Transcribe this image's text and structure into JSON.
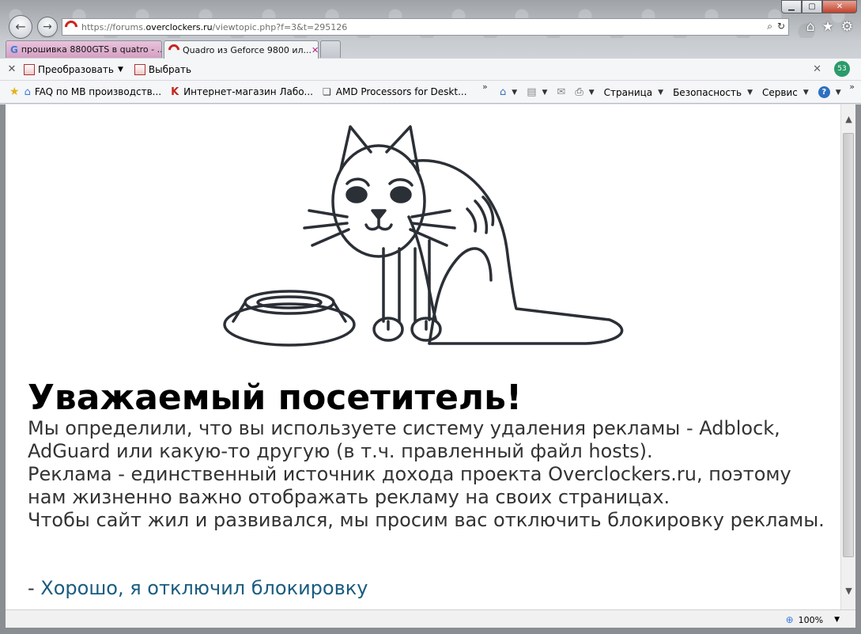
{
  "window": {
    "min_glyph": "▁",
    "max_glyph": "▢",
    "close_glyph": "✕"
  },
  "nav": {
    "back_glyph": "←",
    "fwd_glyph": "→"
  },
  "address": {
    "url_prefix": "https://forums.",
    "url_domain": "overclockers.ru",
    "url_suffix": "/viewtopic.php?f=3&t=295126",
    "search_glyph": "⌕",
    "refresh_glyph": "↻"
  },
  "right_icons": {
    "home": "⌂",
    "favorites": "★",
    "tools": "⚙"
  },
  "tabs": [
    {
      "label": "прошивка 8800GTS в quatro - ...",
      "icon": "G"
    },
    {
      "label": "Quadro из Geforce 9800 ил...",
      "close": "✕"
    }
  ],
  "command_bar": {
    "close": "✕",
    "convert": "Преобразовать",
    "select": "Выбрать",
    "right_close": "✕",
    "badge": "53"
  },
  "favorites": [
    {
      "label": "FAQ по МВ производств..."
    },
    {
      "label": "Интернет-магазин  Лабо..."
    },
    {
      "label": "AMD Processors for Deskt..."
    }
  ],
  "chevron": "»",
  "tools": {
    "page": "Страница",
    "safety": "Безопасность",
    "service": "Сервис",
    "help": "?"
  },
  "page": {
    "headline": "Уважаемый посетитель!",
    "lines": [
      "Мы определили, что вы используете систему удаления рекламы - Adblock,",
      "AdGuard или какую-то другую (в т.ч. правленный файл hosts).",
      "Реклама - единственный источник дохода проекта Overclockers.ru, поэтому",
      "нам жизненно важно отображать рекламу на своих страницах.",
      "Чтобы сайт жил и развивался, мы просим вас отключить блокировку рекламы."
    ],
    "ok_prefix": "- ",
    "ok_link": "Хорошо, я отключил блокировку"
  },
  "status": {
    "zoom": "100%"
  },
  "colors": {
    "link": "#1a5c80",
    "text": "#333333",
    "cat_stroke": "#2b2f36"
  }
}
